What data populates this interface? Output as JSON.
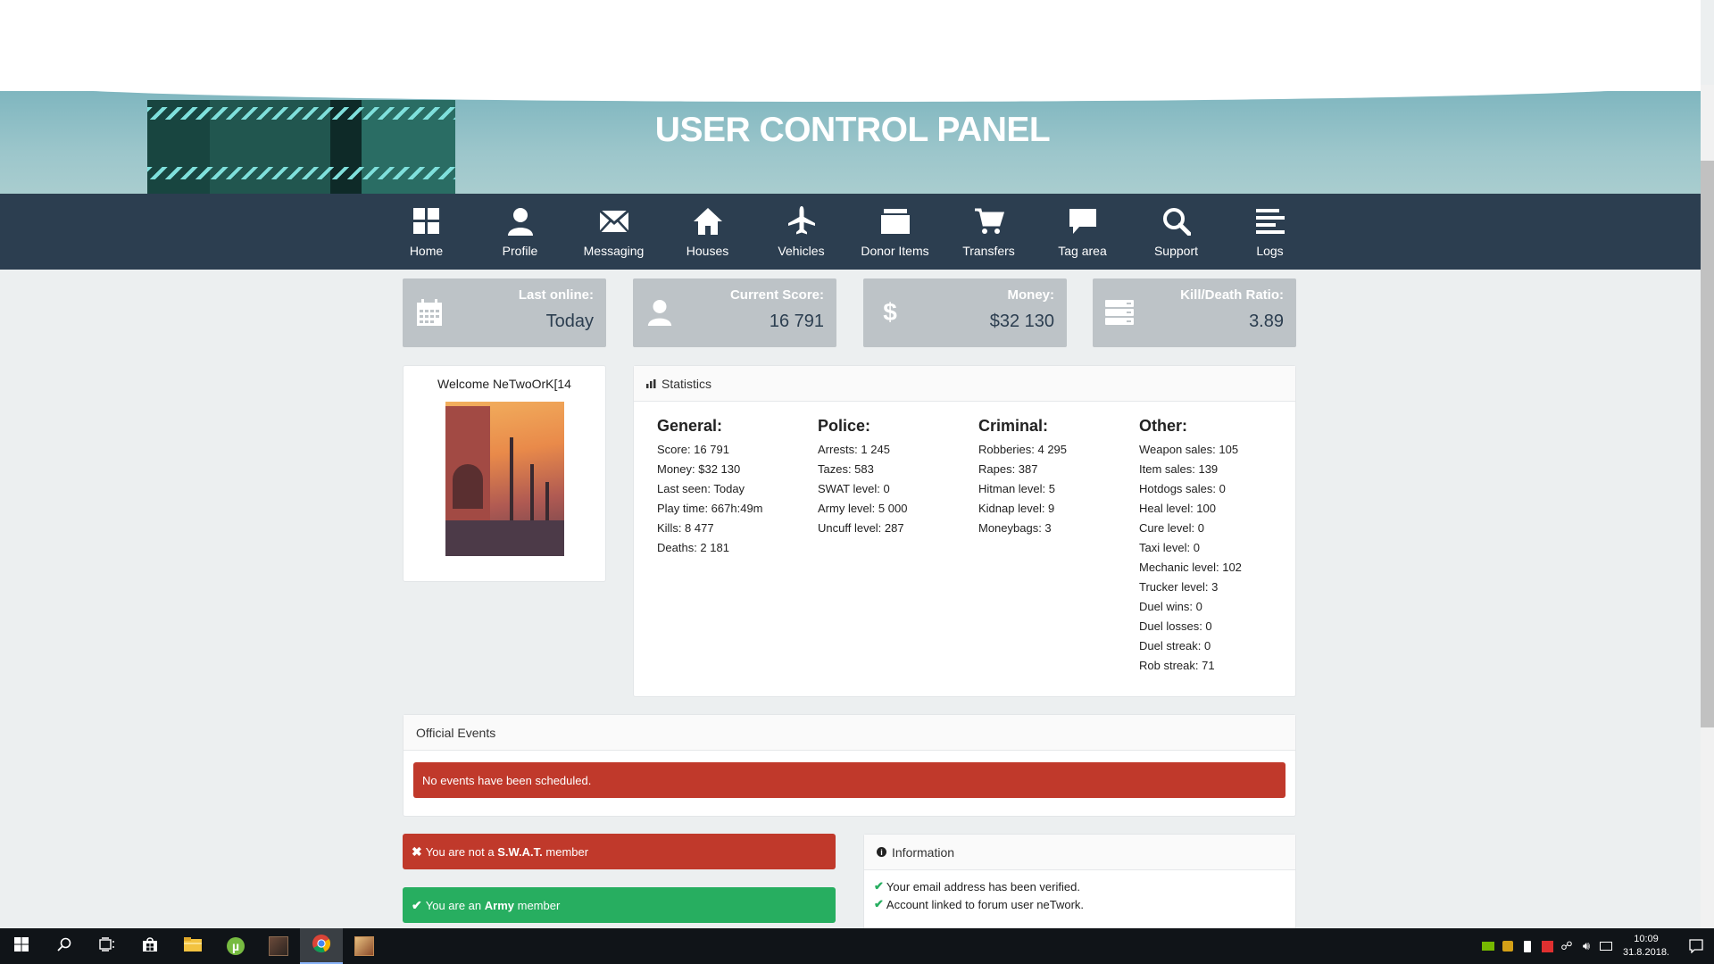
{
  "header": {
    "title": "USER CONTROL PANEL"
  },
  "nav": [
    {
      "label": "Home",
      "icon": "home-icon"
    },
    {
      "label": "Profile",
      "icon": "user-icon"
    },
    {
      "label": "Messaging",
      "icon": "envelope-icon"
    },
    {
      "label": "Houses",
      "icon": "house-icon"
    },
    {
      "label": "Vehicles",
      "icon": "plane-icon"
    },
    {
      "label": "Donor Items",
      "icon": "folder-icon"
    },
    {
      "label": "Transfers",
      "icon": "cart-icon"
    },
    {
      "label": "Tag area",
      "icon": "chat-icon"
    },
    {
      "label": "Support",
      "icon": "search-icon"
    },
    {
      "label": "Logs",
      "icon": "list-icon"
    }
  ],
  "cards": [
    {
      "label": "Last online:",
      "value": "Today",
      "icon": "calendar-icon"
    },
    {
      "label": "Current Score:",
      "value": "16 791",
      "icon": "user-icon"
    },
    {
      "label": "Money:",
      "value": "$32 130",
      "icon": "dollar-icon"
    },
    {
      "label": "Kill/Death Ratio:",
      "value": "3.89",
      "icon": "server-icon"
    }
  ],
  "welcome": {
    "text": "Welcome NeTwoOrK[14"
  },
  "statistics": {
    "title": "Statistics",
    "columns": [
      {
        "heading": "General:",
        "items": [
          "Score: 16 791",
          "Money: $32 130",
          "Last seen: Today",
          "Play time: 667h:49m",
          "Kills: 8 477",
          "Deaths: 2 181"
        ]
      },
      {
        "heading": "Police:",
        "items": [
          "Arrests: 1 245",
          "Tazes: 583",
          "SWAT level: 0",
          "Army level: 5 000",
          "Uncuff level: 287"
        ]
      },
      {
        "heading": "Criminal:",
        "items": [
          "Robberies: 4 295",
          "Rapes: 387",
          "Hitman level: 5",
          "Kidnap level: 9",
          "Moneybags: 3"
        ]
      },
      {
        "heading": "Other:",
        "items": [
          "Weapon sales: 105",
          "Item sales: 139",
          "Hotdogs sales: 0",
          "Heal level: 100",
          "Cure level: 0",
          "Taxi level: 0",
          "Mechanic level: 102",
          "Trucker level: 3",
          "Duel wins: 0",
          "Duel losses: 0",
          "Duel streak: 0",
          "Rob streak: 71"
        ]
      }
    ]
  },
  "events": {
    "title": "Official Events",
    "message": "No events have been scheduled."
  },
  "membership": {
    "swat_prefix": "You are not a ",
    "swat_strong": "S.W.A.T.",
    "swat_suffix": " member",
    "army_prefix": "You are an ",
    "army_strong": "Army",
    "army_suffix": " member"
  },
  "information": {
    "title": "Information",
    "lines": [
      "Your email address has been verified.",
      "Account linked to forum user neTwork."
    ]
  },
  "taskbar": {
    "time": "10:09",
    "date": "31.8.2018."
  },
  "colors": {
    "nav_bg": "#2c3e50",
    "card_bg": "#bdc3c7",
    "danger": "#c0392b",
    "success": "#27ae60"
  }
}
